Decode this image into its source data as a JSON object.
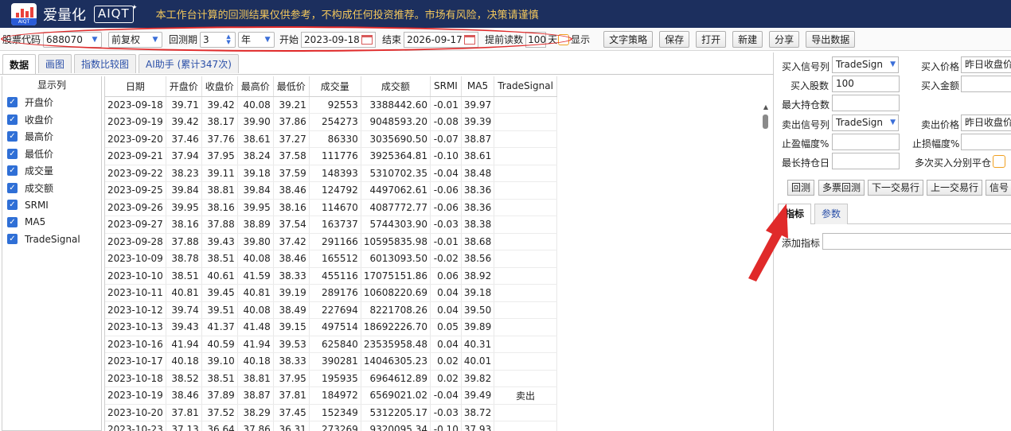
{
  "header": {
    "brand": "爱量化",
    "brand_tag": "AIQT",
    "logo_caption": "AIQT",
    "notice": "本工作台计算的回测结果仅供参考，不构成任何投资推荐。市场有风险，决策请谨慎"
  },
  "toolbar": {
    "stock_code_label": "股票代码",
    "stock_code": "688070",
    "adjust": "前复权",
    "backtest_label": "回测期",
    "backtest_value": "3",
    "backtest_unit": "年",
    "start_label": "开始",
    "start_date": "2023-09-18",
    "end_label": "结束",
    "end_date": "2026-09-17",
    "preread_label": "提前读数",
    "preread_value": "100",
    "preread_unit": "天",
    "show_label": "显示",
    "buttons": [
      "文字策略",
      "保存",
      "打开",
      "新建",
      "分享",
      "导出数据"
    ]
  },
  "tabs": [
    "数据",
    "画图",
    "指数比较图",
    "AI助手 (累计347次)"
  ],
  "columns_panel": {
    "title": "显示列",
    "items": [
      "开盘价",
      "收盘价",
      "最高价",
      "最低价",
      "成交量",
      "成交额",
      "SRMI",
      "MA5",
      "TradeSignal"
    ]
  },
  "table": {
    "headers": [
      "日期",
      "开盘价",
      "收盘价",
      "最高价",
      "最低价",
      "成交量",
      "成交额",
      "SRMI",
      "MA5",
      "TradeSignal"
    ],
    "rows": [
      [
        "2023-09-18",
        "39.71",
        "39.42",
        "40.08",
        "39.21",
        "92553",
        "3388442.60",
        "-0.01",
        "39.97",
        ""
      ],
      [
        "2023-09-19",
        "39.42",
        "38.17",
        "39.90",
        "37.86",
        "254273",
        "9048593.20",
        "-0.08",
        "39.39",
        ""
      ],
      [
        "2023-09-20",
        "37.46",
        "37.76",
        "38.61",
        "37.27",
        "86330",
        "3035690.50",
        "-0.07",
        "38.87",
        ""
      ],
      [
        "2023-09-21",
        "37.94",
        "37.95",
        "38.24",
        "37.58",
        "111776",
        "3925364.81",
        "-0.10",
        "38.61",
        ""
      ],
      [
        "2023-09-22",
        "38.23",
        "39.11",
        "39.18",
        "37.59",
        "148393",
        "5310702.35",
        "-0.04",
        "38.48",
        ""
      ],
      [
        "2023-09-25",
        "39.84",
        "38.81",
        "39.84",
        "38.46",
        "124792",
        "4497062.61",
        "-0.06",
        "38.36",
        ""
      ],
      [
        "2023-09-26",
        "39.95",
        "38.16",
        "39.95",
        "38.16",
        "114670",
        "4087772.77",
        "-0.06",
        "38.36",
        ""
      ],
      [
        "2023-09-27",
        "38.16",
        "37.88",
        "38.89",
        "37.54",
        "163737",
        "5744303.90",
        "-0.03",
        "38.38",
        ""
      ],
      [
        "2023-09-28",
        "37.88",
        "39.43",
        "39.80",
        "37.42",
        "291166",
        "10595835.98",
        "-0.01",
        "38.68",
        ""
      ],
      [
        "2023-10-09",
        "38.78",
        "38.51",
        "40.08",
        "38.46",
        "165512",
        "6013093.50",
        "-0.02",
        "38.56",
        ""
      ],
      [
        "2023-10-10",
        "38.51",
        "40.61",
        "41.59",
        "38.33",
        "455116",
        "17075151.86",
        "0.06",
        "38.92",
        ""
      ],
      [
        "2023-10-11",
        "40.81",
        "39.45",
        "40.81",
        "39.19",
        "289176",
        "10608220.69",
        "0.04",
        "39.18",
        ""
      ],
      [
        "2023-10-12",
        "39.74",
        "39.51",
        "40.08",
        "38.49",
        "227694",
        "8221708.26",
        "0.04",
        "39.50",
        ""
      ],
      [
        "2023-10-13",
        "39.43",
        "41.37",
        "41.48",
        "39.15",
        "497514",
        "18692226.70",
        "0.05",
        "39.89",
        ""
      ],
      [
        "2023-10-16",
        "41.94",
        "40.59",
        "41.94",
        "39.53",
        "625840",
        "23535958.48",
        "0.04",
        "40.31",
        ""
      ],
      [
        "2023-10-17",
        "40.18",
        "39.10",
        "40.18",
        "38.33",
        "390281",
        "14046305.23",
        "0.02",
        "40.01",
        ""
      ],
      [
        "2023-10-18",
        "38.52",
        "38.51",
        "38.81",
        "37.95",
        "195935",
        "6964612.89",
        "0.02",
        "39.82",
        ""
      ],
      [
        "2023-10-19",
        "38.46",
        "37.89",
        "38.87",
        "37.81",
        "184972",
        "6569021.02",
        "-0.04",
        "39.49",
        "卖出"
      ],
      [
        "2023-10-20",
        "37.81",
        "37.52",
        "38.29",
        "37.45",
        "152349",
        "5312205.17",
        "-0.03",
        "38.72",
        ""
      ],
      [
        "2023-10-23",
        "37.13",
        "36.64",
        "37.86",
        "36.31",
        "273269",
        "9320095.34",
        "-0.10",
        "37.93",
        ""
      ]
    ]
  },
  "right_panel": {
    "buy_signal_label": "买入信号列",
    "buy_signal": "TradeSign",
    "buy_price_label": "买入价格",
    "buy_price": "昨日收盘价",
    "buy_shares_label": "买入股数",
    "buy_shares": "100",
    "buy_amount_label": "买入金额",
    "max_hold_label": "最大持仓数",
    "sell_signal_label": "卖出信号列",
    "sell_signal": "TradeSign",
    "sell_price_label": "卖出价格",
    "sell_price": "昨日收盘价",
    "take_profit_label": "止盈幅度%",
    "stop_loss_label": "止损幅度%",
    "max_days_label": "最长持仓日",
    "multi_buy_label": "多次买入分别平仓",
    "actions": [
      "回测",
      "多票回测",
      "下一交易行",
      "上一交易行",
      "信号"
    ],
    "tabs": [
      "指标",
      "参数"
    ],
    "add_indicator_label": "添加指标"
  }
}
